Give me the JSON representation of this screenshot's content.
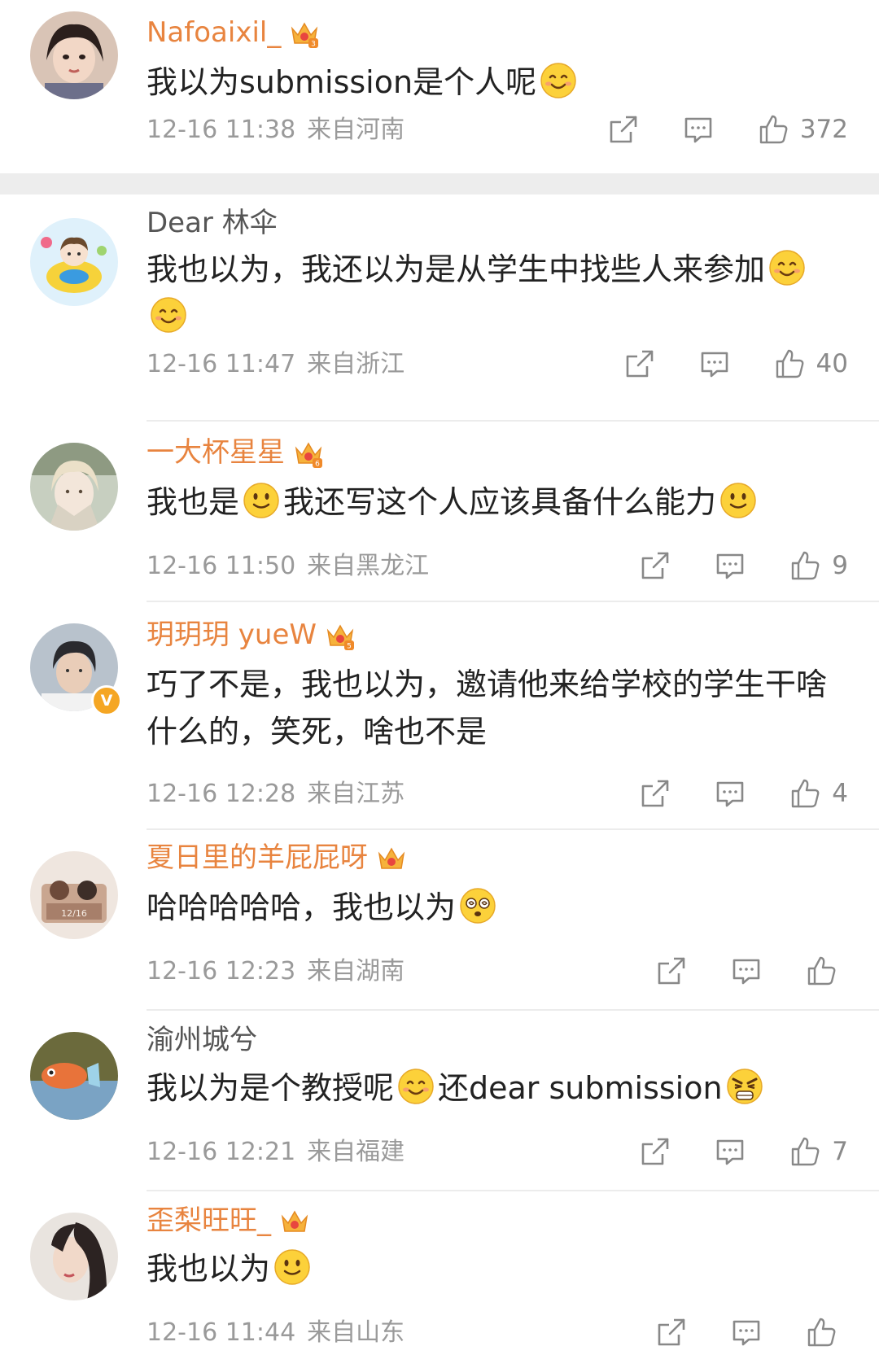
{
  "colors": {
    "vip_name": "#e8843f",
    "normal_name": "#555555",
    "text": "#222222",
    "meta": "#9a9a9a",
    "separator": "#ededed"
  },
  "comments": [
    {
      "username": "Nafoaixil_",
      "name_style": "vip",
      "badge": "crown-3",
      "segments": [
        "我以为submission是个人呢",
        "[emoji:smile]"
      ],
      "time": "12-16 11:38",
      "location": "来自河南",
      "likes": "372"
    },
    {
      "username": "Dear 林伞",
      "name_style": "normal",
      "segments": [
        "我也以为，我还以为是从学生中找些人来参加",
        "[emoji:smile]",
        "[emoji:smile]"
      ],
      "time": "12-16 11:47",
      "location": "来自浙江",
      "likes": "40"
    },
    {
      "username": "一大杯星星",
      "name_style": "vip",
      "badge": "crown-6",
      "segments": [
        "我也是",
        "[emoji:plain-smile]",
        "我还写这个人应该具备什么能力",
        "[emoji:plain-smile]"
      ],
      "time": "12-16 11:50",
      "location": "来自黑龙江",
      "likes": "9"
    },
    {
      "username": "玥玥玥 yueW",
      "name_style": "vip",
      "badge": "crown-5",
      "verified": true,
      "segments": [
        "巧了不是，我也以为，邀请他来给学校的学生干啥什么的，笑死，啥也不是"
      ],
      "time": "12-16 12:28",
      "location": "来自江苏",
      "likes": "4"
    },
    {
      "username": "夏日里的羊屁屁呀",
      "name_style": "vip",
      "badge": "crown",
      "segments": [
        "哈哈哈哈哈，我也以为",
        "[emoji:dizzy]"
      ],
      "time": "12-16 12:23",
      "location": "来自湖南",
      "likes": ""
    },
    {
      "username": "渝州城兮",
      "name_style": "normal",
      "segments": [
        "我以为是个教授呢",
        "[emoji:smile]",
        "还dear submission",
        "[emoji:angry]"
      ],
      "time": "12-16 12:21",
      "location": "来自福建",
      "likes": "7"
    },
    {
      "username": "歪梨旺旺_",
      "name_style": "vip",
      "badge": "crown",
      "segments": [
        "我也以为",
        "[emoji:plain-smile]"
      ],
      "time": "12-16 11:44",
      "location": "来自山东",
      "likes": ""
    }
  ],
  "icons": {
    "repost": "repost-icon",
    "comment": "comment-icon",
    "like": "thumbs-up-icon"
  }
}
